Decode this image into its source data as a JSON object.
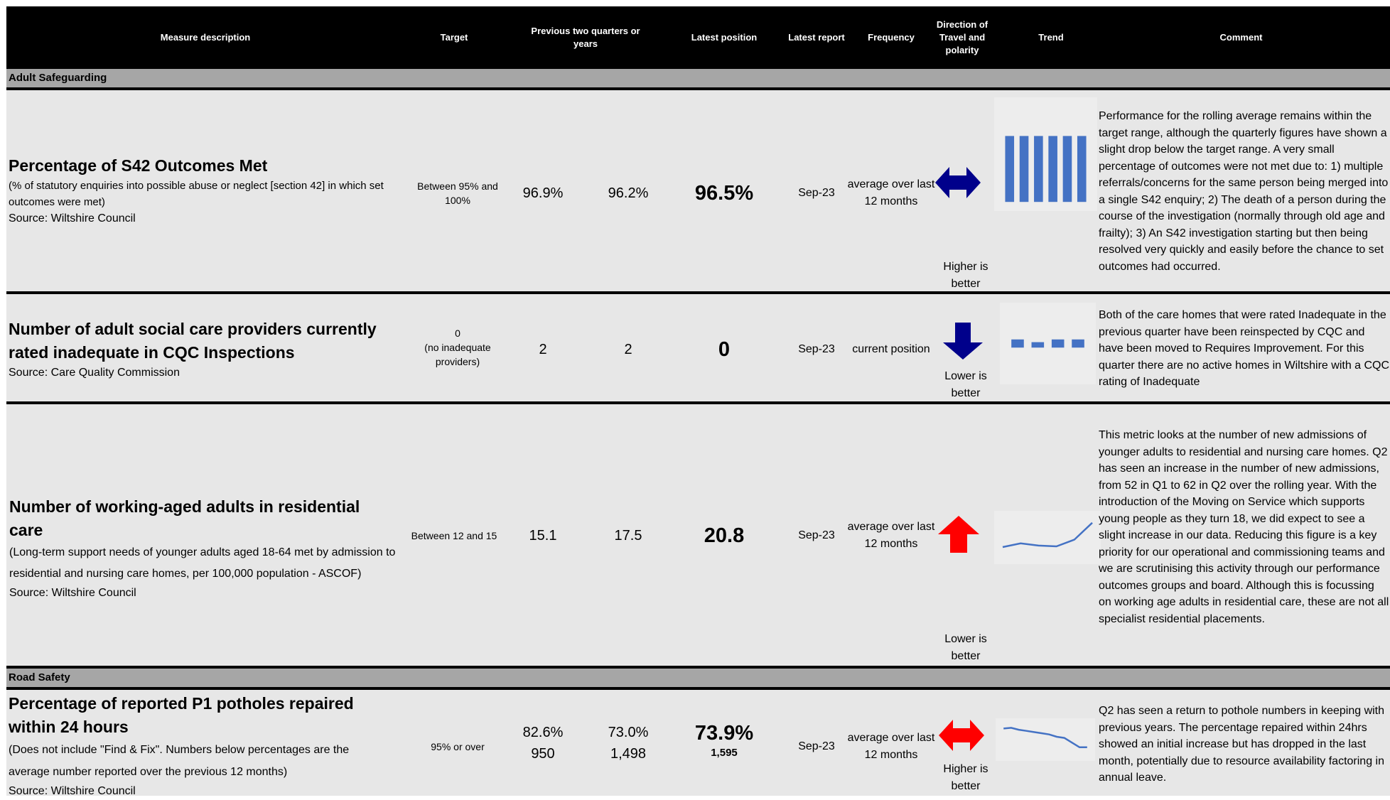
{
  "header": {
    "measure": "Measure description",
    "target": "Target",
    "previous": "Previous two quarters or years",
    "latest_position": "Latest position",
    "latest_report": "Latest report",
    "frequency": "Frequency",
    "direction": "Direction of Travel and polarity",
    "trend": "Trend",
    "comment": "Comment"
  },
  "sections": {
    "adult": "Adult Safeguarding",
    "road": "Road Safety"
  },
  "rows": [
    {
      "title": "Percentage of S42 Outcomes Met",
      "subtitle": "(% of statutory enquiries into possible abuse or neglect [section 42] in which set outcomes were met)",
      "source": "Source: Wiltshire Council",
      "target": "Between 95% and 100%",
      "prev1": "96.9%",
      "prev2": "96.2%",
      "latest": "96.5%",
      "report": "Sep-23",
      "frequency": "average over last 12 months",
      "direction_icon": "double-horizontal-arrow-icon",
      "direction_color": "#00008b",
      "polarity": "Higher is better",
      "trend": {
        "type": "bar",
        "values": [
          1,
          1,
          1,
          1,
          1,
          1
        ],
        "color": "#4472c4"
      },
      "comment": "Performance for the rolling average remains within the target range, although the quarterly figures have shown a slight drop below the target range. A very small percentage of outcomes were not met due to: 1) multiple referrals/concerns for the same person being merged into a single S42 enquiry; 2) The death of a person during the course of the investigation (normally through old age and frailty); 3) An S42 investigation starting but then being resolved very quickly and easily before the chance to set outcomes had occurred."
    },
    {
      "title": "Number of adult social care providers currently rated inadequate in CQC Inspections",
      "source": "Source: Care Quality Commission",
      "target_line1": "0",
      "target_line2": "(no inadequate providers)",
      "prev1": "2",
      "prev2": "2",
      "latest": "0",
      "report": "Sep-23",
      "frequency": "current position",
      "direction_icon": "down-arrow-icon",
      "direction_color": "#00008b",
      "polarity": "Lower is better",
      "trend": {
        "type": "bar",
        "values": [
          3,
          2,
          3,
          3
        ],
        "color": "#4472c4"
      },
      "comment": "Both of the care homes that were rated Inadequate in the previous quarter have been reinspected by CQC and have been moved to Requires Improvement. For this quarter there are no active homes in Wiltshire with a CQC rating of Inadequate"
    },
    {
      "title": "Number of working-aged adults in residential care",
      "subtitle": "(Long-term support needs of younger adults aged 18-64 met by admission to residential and nursing care homes, per 100,000 population - ASCOF)",
      "source": "Source: Wiltshire Council",
      "target": "Between 12 and 15",
      "prev1": "15.1",
      "prev2": "17.5",
      "latest": "20.8",
      "report": "Sep-23",
      "frequency": "average over last 12 months",
      "direction_icon": "up-arrow-icon",
      "direction_color": "#ff0000",
      "polarity": "Lower is better",
      "trend": {
        "type": "line",
        "values": [
          15.3,
          15.8,
          15.5,
          15.4,
          16.3,
          18.6
        ],
        "color": "#4472c4"
      },
      "comment": "This metric looks at the number of new admissions of younger adults to residential and nursing care homes. Q2 has seen an increase in the number of new admissions, from 52 in Q1 to 62 in Q2 over the rolling year. With the introduction of the Moving on Service which supports young people as they turn 18, we did expect to see a slight increase in our data. Reducing this figure is a key priority for our operational and commissioning teams and we are scrutinising this activity through our performance outcomes groups and board. Although this is focussing on working age adults in residential care, these are not all specialist residential placements."
    },
    {
      "title": "Percentage of reported P1 potholes repaired within 24 hours",
      "subtitle": "(Does not include \"Find & Fix\". Numbers below percentages are the average number reported over the previous 12 months)",
      "source": "Source: Wiltshire Council",
      "target": "95% or over",
      "prev1": "82.6%",
      "prev1_count": "950",
      "prev2": "73.0%",
      "prev2_count": "1,498",
      "latest": "73.9%",
      "latest_count": "1,595",
      "report": "Sep-23",
      "frequency": "average over last 12 months",
      "direction_icon": "double-horizontal-arrow-icon",
      "direction_color": "#ff0000",
      "polarity": "Higher is better",
      "trend": {
        "type": "line",
        "values": [
          82.0,
          82.3,
          81.5,
          81.0,
          80.5,
          80.0,
          79.5,
          78.5,
          78.0,
          76.0,
          74.0,
          74.0
        ],
        "color": "#4472c4"
      },
      "comment": "Q2 has seen a return to pothole numbers in keeping with previous years. The percentage repaired within 24hrs showed an initial increase but has dropped in the last month, potentially due to resource availability factoring in annual leave."
    }
  ]
}
